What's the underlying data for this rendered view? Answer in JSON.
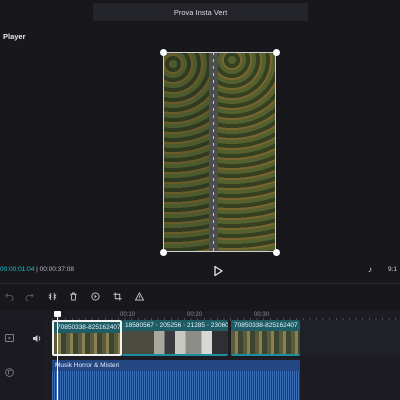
{
  "window": {
    "title": "Prova Insta Vert"
  },
  "player": {
    "label": "Player",
    "current_time": "00:00:01:04",
    "separator": " | ",
    "total_time": "00:00:37:08",
    "aspect_ratio": "9:1"
  },
  "toolbar": {
    "tools": [
      {
        "name": "undo",
        "icon": "undo-icon"
      },
      {
        "name": "redo",
        "icon": "redo-icon"
      },
      {
        "name": "split",
        "icon": "split-icon"
      },
      {
        "name": "delete",
        "icon": "trash-icon"
      },
      {
        "name": "replace",
        "icon": "replace-icon"
      },
      {
        "name": "crop",
        "icon": "crop-icon"
      },
      {
        "name": "warning",
        "icon": "warning-icon"
      }
    ]
  },
  "timeline": {
    "ticks": [
      "00:10",
      "00:20",
      "00:30"
    ],
    "clips": [
      {
        "title": "70850338-825162407"
      },
      {
        "title": "18580567 ⋅ 205256 ⋅ 21285 ⋅ 23060"
      },
      {
        "title": "70850338-825162407"
      }
    ],
    "music": {
      "title": "Musik Horror & Misteri"
    }
  },
  "colors": {
    "accent": "#1cc4d4",
    "clip": "#1f5c66",
    "music": "#1e3c6e"
  }
}
